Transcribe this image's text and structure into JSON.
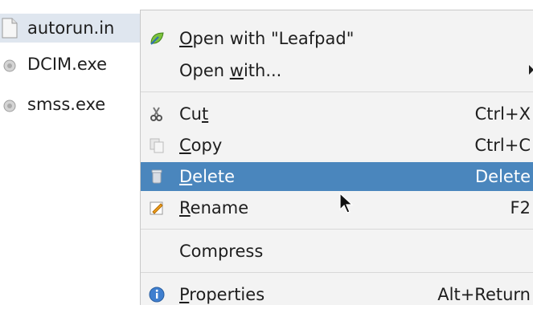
{
  "files": [
    {
      "name": "autorun.in",
      "icon": "text-file-icon"
    },
    {
      "name": "DCIM.exe",
      "icon": "executable-icon"
    },
    {
      "name": "smss.exe",
      "icon": "executable-icon"
    }
  ],
  "menu": {
    "open_with_app": {
      "mnemonic": "O",
      "rest": "pen with \"Leafpad\""
    },
    "open_with": {
      "before": "Open ",
      "mnemonic": "w",
      "after": "ith..."
    },
    "cut": {
      "before": "Cu",
      "mnemonic": "t",
      "accel": "Ctrl+X"
    },
    "copy": {
      "mnemonic": "C",
      "after": "opy",
      "accel": "Ctrl+C"
    },
    "delete": {
      "mnemonic": "D",
      "after": "elete",
      "accel": "Delete"
    },
    "rename": {
      "mnemonic": "R",
      "after": "ename",
      "accel": "F2"
    },
    "compress": {
      "label": "Compress"
    },
    "properties": {
      "mnemonic": "P",
      "after": "roperties",
      "accel": "Alt+Return"
    }
  },
  "colors": {
    "highlight": "#4a86bd",
    "menu_bg": "#f3f3f3",
    "selected_row": "#dfe6ef"
  }
}
